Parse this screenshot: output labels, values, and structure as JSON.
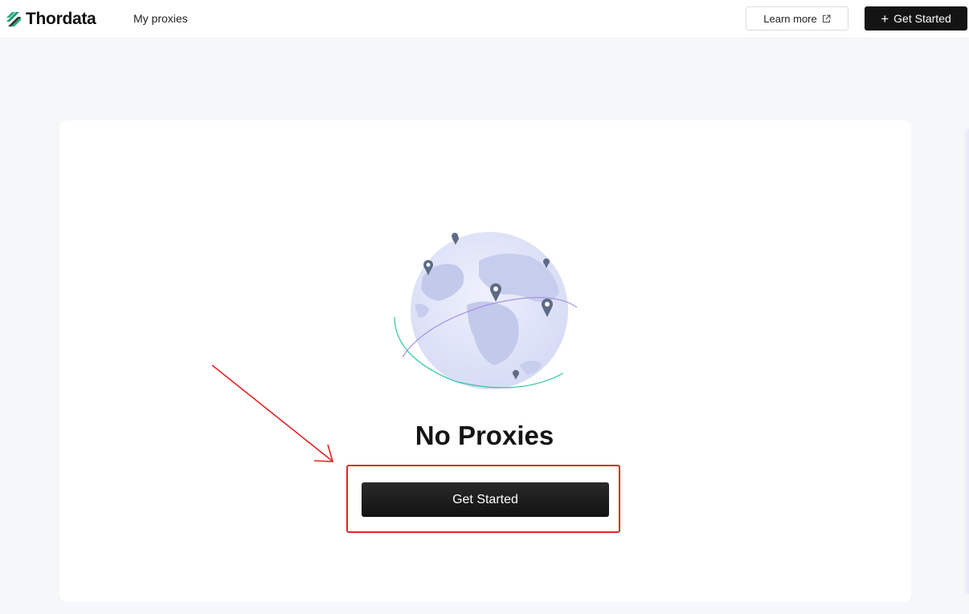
{
  "brand": {
    "name": "Thordata",
    "accent": "#22b07d"
  },
  "nav": {
    "my_proxies": "My proxies"
  },
  "header": {
    "learn_more_label": "Learn more",
    "learn_more_icon": "external-link-icon",
    "get_started_label": "Get Started",
    "get_started_icon": "plus-icon"
  },
  "empty_state": {
    "illustration": "globe-icon",
    "title": "No Proxies",
    "cta_label": "Get Started"
  },
  "annotation": {
    "color": "#e02424"
  }
}
